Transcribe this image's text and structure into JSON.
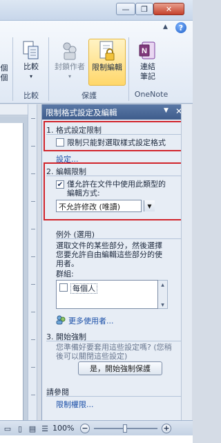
{
  "window": {
    "minimize_glyph": "—",
    "maximize_glyph": "❐",
    "close_glyph": "✕"
  },
  "ribbon": {
    "help_glyph": "?",
    "partial_labels": [
      "個",
      "個"
    ],
    "buttons": [
      {
        "label": "比較",
        "icon": "compare-icon",
        "has_dropdown": true
      },
      {
        "label": "封鎖作者",
        "icon": "block-authors-icon",
        "has_dropdown": true,
        "disabled": true
      },
      {
        "label": "限制編輯",
        "icon": "restrict-editing-icon",
        "active": true
      },
      {
        "label": "連結\n筆記",
        "icon": "onenote-icon"
      }
    ],
    "groups": [
      "比較",
      "保護",
      "OneNote"
    ]
  },
  "pane": {
    "title": "限制格式設定及編輯",
    "section1": {
      "title": "1. 格式設定限制",
      "checkbox_label": "限制只能對選取樣式設定格式",
      "checked": false,
      "settings_link": "設定..."
    },
    "section2": {
      "title": "2. 編輯限制",
      "checkbox_label_line1": "僅允許在文件中使用此類型的",
      "checkbox_label_line2": "編輯方式:",
      "checked": true,
      "select_value": "不允許修改 (唯讀)"
    },
    "exceptions": {
      "title": "例外 (選用)",
      "desc_line1": "選取文件的某些部分，然後選擇",
      "desc_line2": "您要允許自由編輯這些部分的使",
      "desc_line3": "用者。",
      "groups_label": "群組:",
      "group_item": "每個人",
      "group_checked": false,
      "more_users_link": "更多使用者..."
    },
    "section3": {
      "title": "3. 開始強制",
      "desc_line1": "您準備好要套用這些設定嗎? (您稍",
      "desc_line2": "後可以關閉這些設定)",
      "button_label": "是，開始強制保護"
    },
    "see_also": {
      "title": "請參閱",
      "link": "限制權限..."
    }
  },
  "statusbar": {
    "zoom": "100%",
    "minus": "−",
    "plus": "+"
  }
}
